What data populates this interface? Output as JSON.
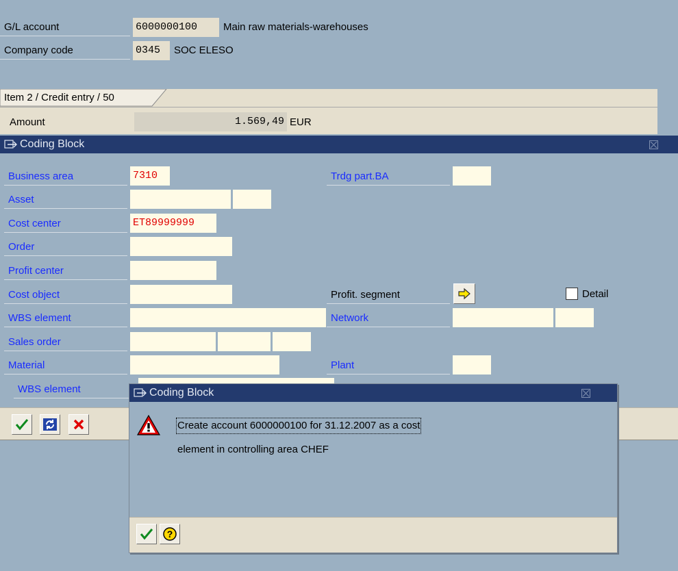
{
  "header": {
    "gl_account_label": "G/L account",
    "gl_account_value": "6000000100",
    "gl_account_desc": "Main raw materials-warehouses",
    "company_code_label": "Company code",
    "company_code_value": "0345",
    "company_code_desc": "SOC ELESO"
  },
  "item": {
    "tab_label": "Item 2 / Credit entry / 50",
    "amount_label": "Amount",
    "amount_value": "1.569,49",
    "currency": "EUR"
  },
  "coding_block": {
    "title": "Coding Block",
    "business_area_label": "Business area",
    "business_area_value": "7310",
    "trdg_part_ba_label": "Trdg part.BA",
    "asset_label": "Asset",
    "cost_center_label": "Cost center",
    "cost_center_value": "ET89999999",
    "order_label": "Order",
    "profit_center_label": "Profit center",
    "cost_object_label": "Cost object",
    "profit_segment_label": "Profit. segment",
    "detail_label": "Detail",
    "wbs_element_label": "WBS element",
    "network_label": "Network",
    "sales_order_label": "Sales order",
    "material_label": "Material",
    "plant_label": "Plant",
    "wbs_element2_label": "WBS element"
  },
  "popup": {
    "title": "Coding Block",
    "message_line1": "Create account 6000000100 for 31.12.2007 as a cost",
    "message_line2": "element in controlling area CHEF"
  },
  "icons": {
    "enter": "checkmark-icon",
    "refresh": "refresh-icon",
    "cancel": "cancel-icon",
    "help": "help-icon",
    "warning": "warning-icon",
    "profit_segment": "arrow-right-icon"
  },
  "colors": {
    "background": "#9bb0c2",
    "titlebar": "#233a6e",
    "label_blue": "#1a2cff",
    "required_red": "#e00000",
    "input_bg": "#fffbe6"
  }
}
